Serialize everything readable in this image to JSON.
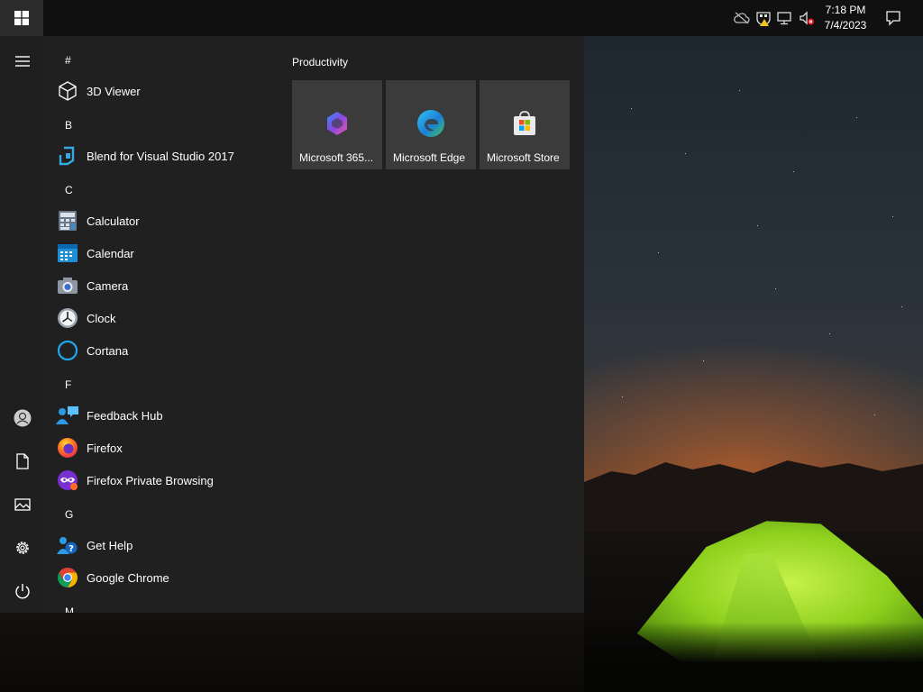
{
  "taskbar": {
    "clock_time": "7:18 PM",
    "clock_date": "7/4/2023",
    "tray_icons": [
      "cloud-offline-icon",
      "security-warning-icon",
      "network-icon",
      "volume-muted-icon",
      "notifications-icon"
    ]
  },
  "start_menu": {
    "rail": [
      "hamburger-icon",
      "user-icon",
      "documents-icon",
      "pictures-icon",
      "settings-icon",
      "power-icon"
    ],
    "letters": {
      "hash": "#",
      "b": "B",
      "c": "C",
      "f": "F",
      "g": "G",
      "m": "M"
    },
    "apps": [
      {
        "label": "3D Viewer",
        "icon": "3d-viewer-icon"
      },
      {
        "label": "Blend for Visual Studio 2017",
        "icon": "blend-icon"
      },
      {
        "label": "Calculator",
        "icon": "calculator-icon"
      },
      {
        "label": "Calendar",
        "icon": "calendar-icon"
      },
      {
        "label": "Camera",
        "icon": "camera-icon"
      },
      {
        "label": "Clock",
        "icon": "clock-icon"
      },
      {
        "label": "Cortana",
        "icon": "cortana-icon"
      },
      {
        "label": "Feedback Hub",
        "icon": "feedback-hub-icon"
      },
      {
        "label": "Firefox",
        "icon": "firefox-icon"
      },
      {
        "label": "Firefox Private Browsing",
        "icon": "firefox-private-icon"
      },
      {
        "label": "Get Help",
        "icon": "get-help-icon"
      },
      {
        "label": "Google Chrome",
        "icon": "chrome-icon"
      }
    ],
    "tile_group": {
      "title": "Productivity",
      "tiles": [
        {
          "label": "Microsoft 365...",
          "icon": "microsoft-365-icon"
        },
        {
          "label": "Microsoft Edge",
          "icon": "edge-icon"
        },
        {
          "label": "Microsoft Store",
          "icon": "store-icon"
        }
      ]
    }
  }
}
